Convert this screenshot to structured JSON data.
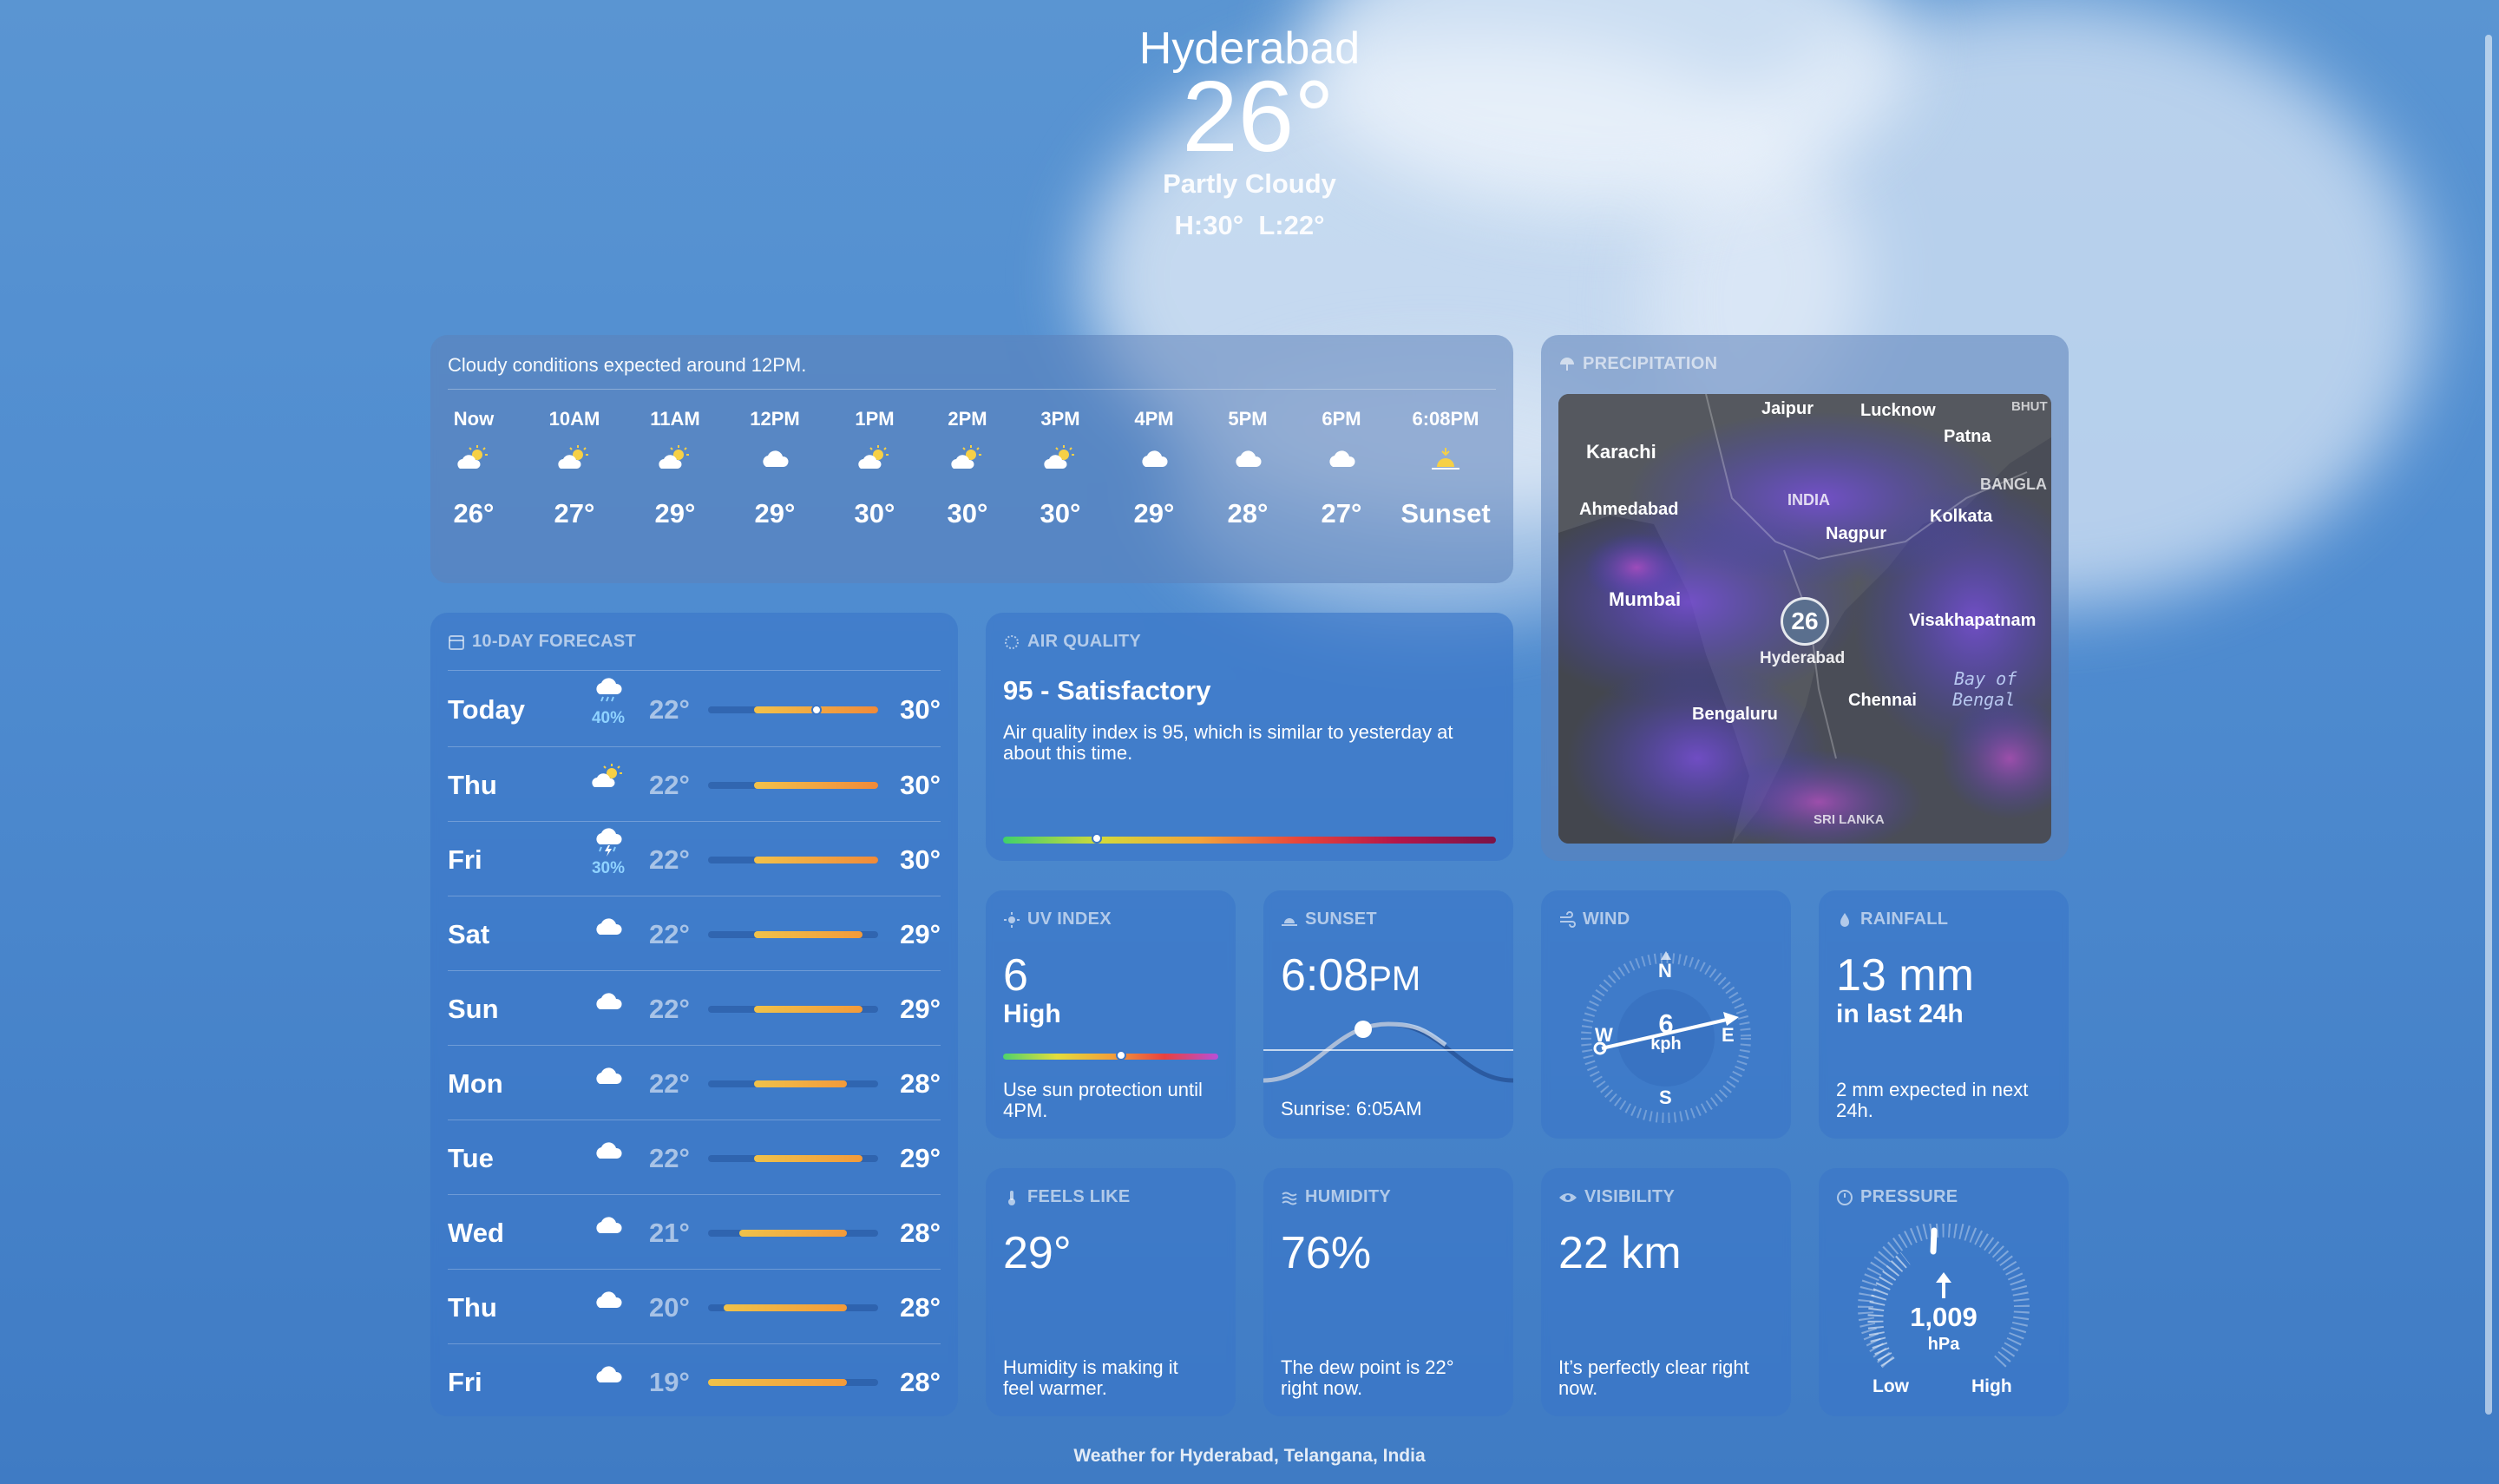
{
  "location": "Hyderabad",
  "current": {
    "temp": "26°",
    "condition": "Partly Cloudy",
    "hilo": "H:30°  L:22°"
  },
  "hourly": {
    "summary": "Cloudy conditions expected around 12PM.",
    "hours": [
      {
        "time": "Now",
        "icon": "partly-cloudy-sun-icon",
        "temp": "26°"
      },
      {
        "time": "10AM",
        "icon": "partly-cloudy-sun-icon",
        "temp": "27°"
      },
      {
        "time": "11AM",
        "icon": "partly-cloudy-sun-icon",
        "temp": "29°"
      },
      {
        "time": "12PM",
        "icon": "cloud-icon",
        "temp": "29°"
      },
      {
        "time": "1PM",
        "icon": "partly-cloudy-sun-icon",
        "temp": "30°"
      },
      {
        "time": "2PM",
        "icon": "partly-cloudy-sun-icon",
        "temp": "30°"
      },
      {
        "time": "3PM",
        "icon": "partly-cloudy-sun-icon",
        "temp": "30°"
      },
      {
        "time": "4PM",
        "icon": "cloud-icon",
        "temp": "29°"
      },
      {
        "time": "5PM",
        "icon": "cloud-icon",
        "temp": "28°"
      },
      {
        "time": "6PM",
        "icon": "cloud-icon",
        "temp": "27°"
      },
      {
        "time": "6:08PM",
        "icon": "sunset-icon",
        "temp": "Sunset"
      }
    ]
  },
  "forecast": {
    "label": "10-DAY FORECAST",
    "range": [
      19,
      30
    ],
    "days": [
      {
        "day": "Today",
        "icon": "cloud-rain-icon",
        "pct": "40%",
        "lo": "22°",
        "hi": "30°",
        "lov": 22,
        "hiv": 30,
        "current": 26
      },
      {
        "day": "Thu",
        "icon": "partly-cloudy-sun-icon",
        "pct": "",
        "lo": "22°",
        "hi": "30°",
        "lov": 22,
        "hiv": 30
      },
      {
        "day": "Fri",
        "icon": "cloud-bolt-rain-icon",
        "pct": "30%",
        "lo": "22°",
        "hi": "30°",
        "lov": 22,
        "hiv": 30
      },
      {
        "day": "Sat",
        "icon": "cloud-icon",
        "pct": "",
        "lo": "22°",
        "hi": "29°",
        "lov": 22,
        "hiv": 29
      },
      {
        "day": "Sun",
        "icon": "cloud-icon",
        "pct": "",
        "lo": "22°",
        "hi": "29°",
        "lov": 22,
        "hiv": 29
      },
      {
        "day": "Mon",
        "icon": "cloud-icon",
        "pct": "",
        "lo": "22°",
        "hi": "28°",
        "lov": 22,
        "hiv": 28
      },
      {
        "day": "Tue",
        "icon": "cloud-icon",
        "pct": "",
        "lo": "22°",
        "hi": "29°",
        "lov": 22,
        "hiv": 29
      },
      {
        "day": "Wed",
        "icon": "cloud-icon",
        "pct": "",
        "lo": "21°",
        "hi": "28°",
        "lov": 21,
        "hiv": 28
      },
      {
        "day": "Thu",
        "icon": "cloud-icon",
        "pct": "",
        "lo": "20°",
        "hi": "28°",
        "lov": 20,
        "hiv": 28
      },
      {
        "day": "Fri",
        "icon": "cloud-icon",
        "pct": "",
        "lo": "19°",
        "hi": "28°",
        "lov": 19,
        "hiv": 28
      }
    ]
  },
  "air_quality": {
    "label": "AIR QUALITY",
    "title": "95 - Satisfactory",
    "desc": "Air quality index is 95, which is similar to yesterday at about this time.",
    "level": 0.19
  },
  "precipitation": {
    "label": "PRECIPITATION",
    "cities": [
      "Jaipur",
      "Lucknow",
      "BHUT",
      "Karachi",
      "Patna",
      "BANGLA",
      "INDIA",
      "Ahmedabad",
      "Kolkata",
      "Nagpur",
      "Mumbai",
      "Visakhapatnam",
      "Hyderabad",
      "Bay of",
      "Bengal",
      "Chennai",
      "Bengaluru",
      "SRI LANKA"
    ],
    "pin_temp": "26"
  },
  "uv": {
    "label": "UV INDEX",
    "value": "6",
    "level_text": "High",
    "note": "Use sun protection until 4PM.",
    "level": 0.55
  },
  "sunset": {
    "label": "SUNSET",
    "time": "6:08",
    "suffix": "PM",
    "sunrise": "Sunrise: 6:05AM"
  },
  "wind": {
    "label": "WIND",
    "speed": "6",
    "unit": "kph",
    "n": "N",
    "s": "S",
    "e": "E",
    "w": "W"
  },
  "rainfall": {
    "label": "RAINFALL",
    "value": "13 mm",
    "period": "in last 24h",
    "note": "2 mm expected in next 24h."
  },
  "feels_like": {
    "label": "FEELS LIKE",
    "value": "29°",
    "note": "Humidity is making it feel warmer."
  },
  "humidity": {
    "label": "HUMIDITY",
    "value": "76%",
    "note": "The dew point is 22° right now."
  },
  "visibility": {
    "label": "VISIBILITY",
    "value": "22 km",
    "note": "It’s perfectly clear right now."
  },
  "pressure": {
    "label": "PRESSURE",
    "value": "1,009",
    "unit": "hPa",
    "low": "Low",
    "high": "High"
  },
  "footer": "Weather for Hyderabad, Telangana, India"
}
